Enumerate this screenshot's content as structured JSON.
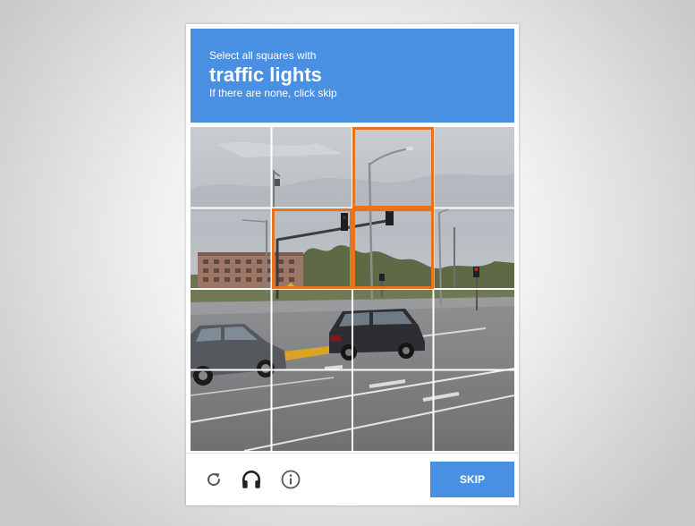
{
  "challenge": {
    "instruction": "Select all squares with",
    "keyword": "traffic lights",
    "hint": "If there are none, click skip"
  },
  "grid": {
    "rows": 4,
    "cols": 4,
    "selected_tiles": [
      2,
      5,
      6
    ]
  },
  "footer": {
    "reload_icon": "reload-icon",
    "audio_icon": "headphones-icon",
    "info_icon": "info-icon",
    "skip_label": "SKIP"
  },
  "colors": {
    "accent": "#4a90e2",
    "selection": "#e8731f"
  }
}
